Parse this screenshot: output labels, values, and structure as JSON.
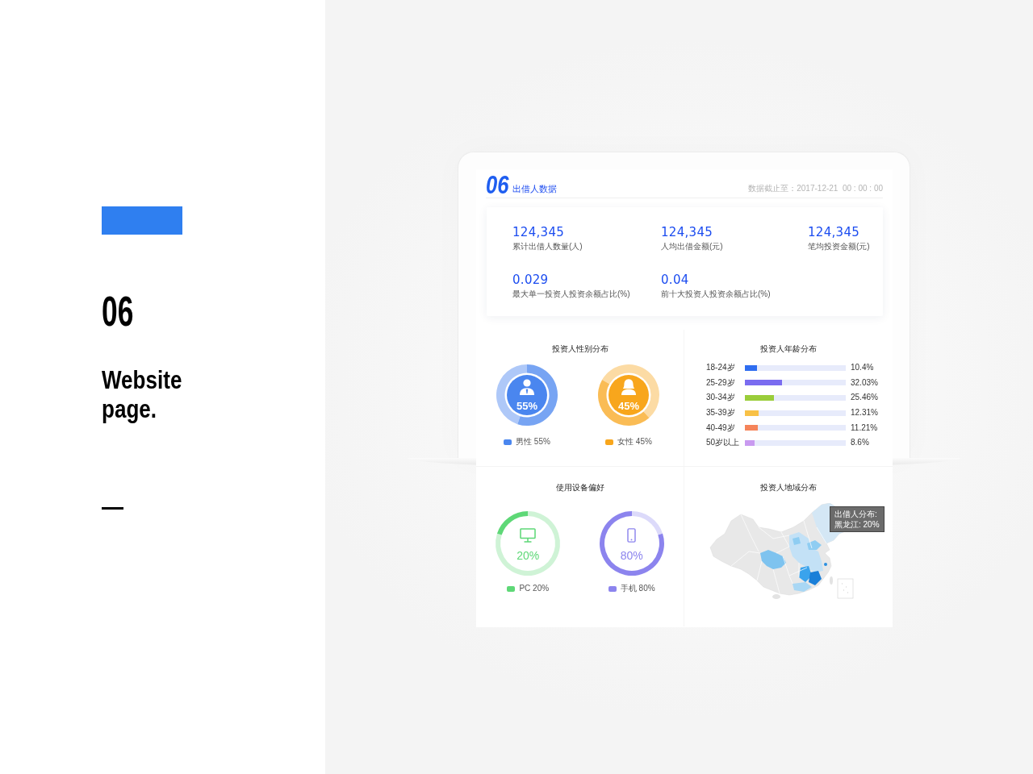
{
  "intro": {
    "number": "06",
    "title": "Website page."
  },
  "header": {
    "logo": "06",
    "title": "出借人数据",
    "timestamp": "数据截止至：2017-12-21  00 : 00 : 00"
  },
  "stats": [
    {
      "value": "124,345",
      "label": "累计出借人数量(人)"
    },
    {
      "value": "124,345",
      "label": "人均出借金额(元)"
    },
    {
      "value": "124,345",
      "label": "笔均投资金额(元)"
    },
    {
      "value": "0.029",
      "label": "最大单一投资人投资余额占比(%)"
    },
    {
      "value": "0.04",
      "label": "前十大投资人投资余额占比(%)"
    }
  ],
  "gender": {
    "title": "投资人性别分布",
    "items": [
      {
        "kind": "male",
        "reading": "55%",
        "legend": "男性 55%",
        "color": "#4a86ef",
        "chart_data": [
          {
            "type": "donut",
            "values": [
              45,
              55
            ],
            "colors": [
              "#aec8f8",
              "#77a4f3"
            ]
          }
        ]
      },
      {
        "kind": "female",
        "reading": "45%",
        "legend": "女性 45%",
        "color": "#f8a61c",
        "chart_data": [
          {
            "type": "donut",
            "values": [
              55,
              45
            ],
            "colors": [
              "#fcdba4",
              "#fabc55"
            ]
          }
        ]
      }
    ]
  },
  "age": {
    "title": "投资人年龄分布",
    "rows": [
      {
        "label": "18-24岁",
        "value": "10.4%",
        "level": 0.117,
        "color": "#2f6df0"
      },
      {
        "label": "25-29岁",
        "value": "32.03%",
        "level": 0.365,
        "color": "#7a6cf0"
      },
      {
        "label": "30-34岁",
        "value": "25.46%",
        "level": 0.285,
        "color": "#9acd3a"
      },
      {
        "label": "35-39岁",
        "value": "12.31%",
        "level": 0.139,
        "color": "#f8c146"
      },
      {
        "label": "40-49岁",
        "value": "11.21%",
        "level": 0.124,
        "color": "#f5845a"
      },
      {
        "label": "50岁以上",
        "value": "8.6%",
        "level": 0.095,
        "color": "#c99af0"
      }
    ]
  },
  "devices": {
    "title": "使用设备偏好",
    "items": [
      {
        "kind": "pc",
        "reading": "20%",
        "legend": "PC 20%",
        "color": "#5ed877",
        "chart_data": [
          {
            "type": "donut",
            "values": [
              80,
              20
            ],
            "colors": [
              "#cff3d6",
              "#5ed877"
            ]
          }
        ]
      },
      {
        "kind": "mobile",
        "reading": "80%",
        "legend": "手机 80%",
        "color": "#8c84ee",
        "chart_data": [
          {
            "type": "donut",
            "values": [
              20,
              80
            ],
            "colors": [
              "#dcdafa",
              "#8c84ee"
            ]
          }
        ]
      }
    ]
  },
  "region": {
    "title": "投资人地域分布",
    "tooltip": {
      "title": "出借人分布:",
      "value": "黑龙江: 20%"
    }
  }
}
